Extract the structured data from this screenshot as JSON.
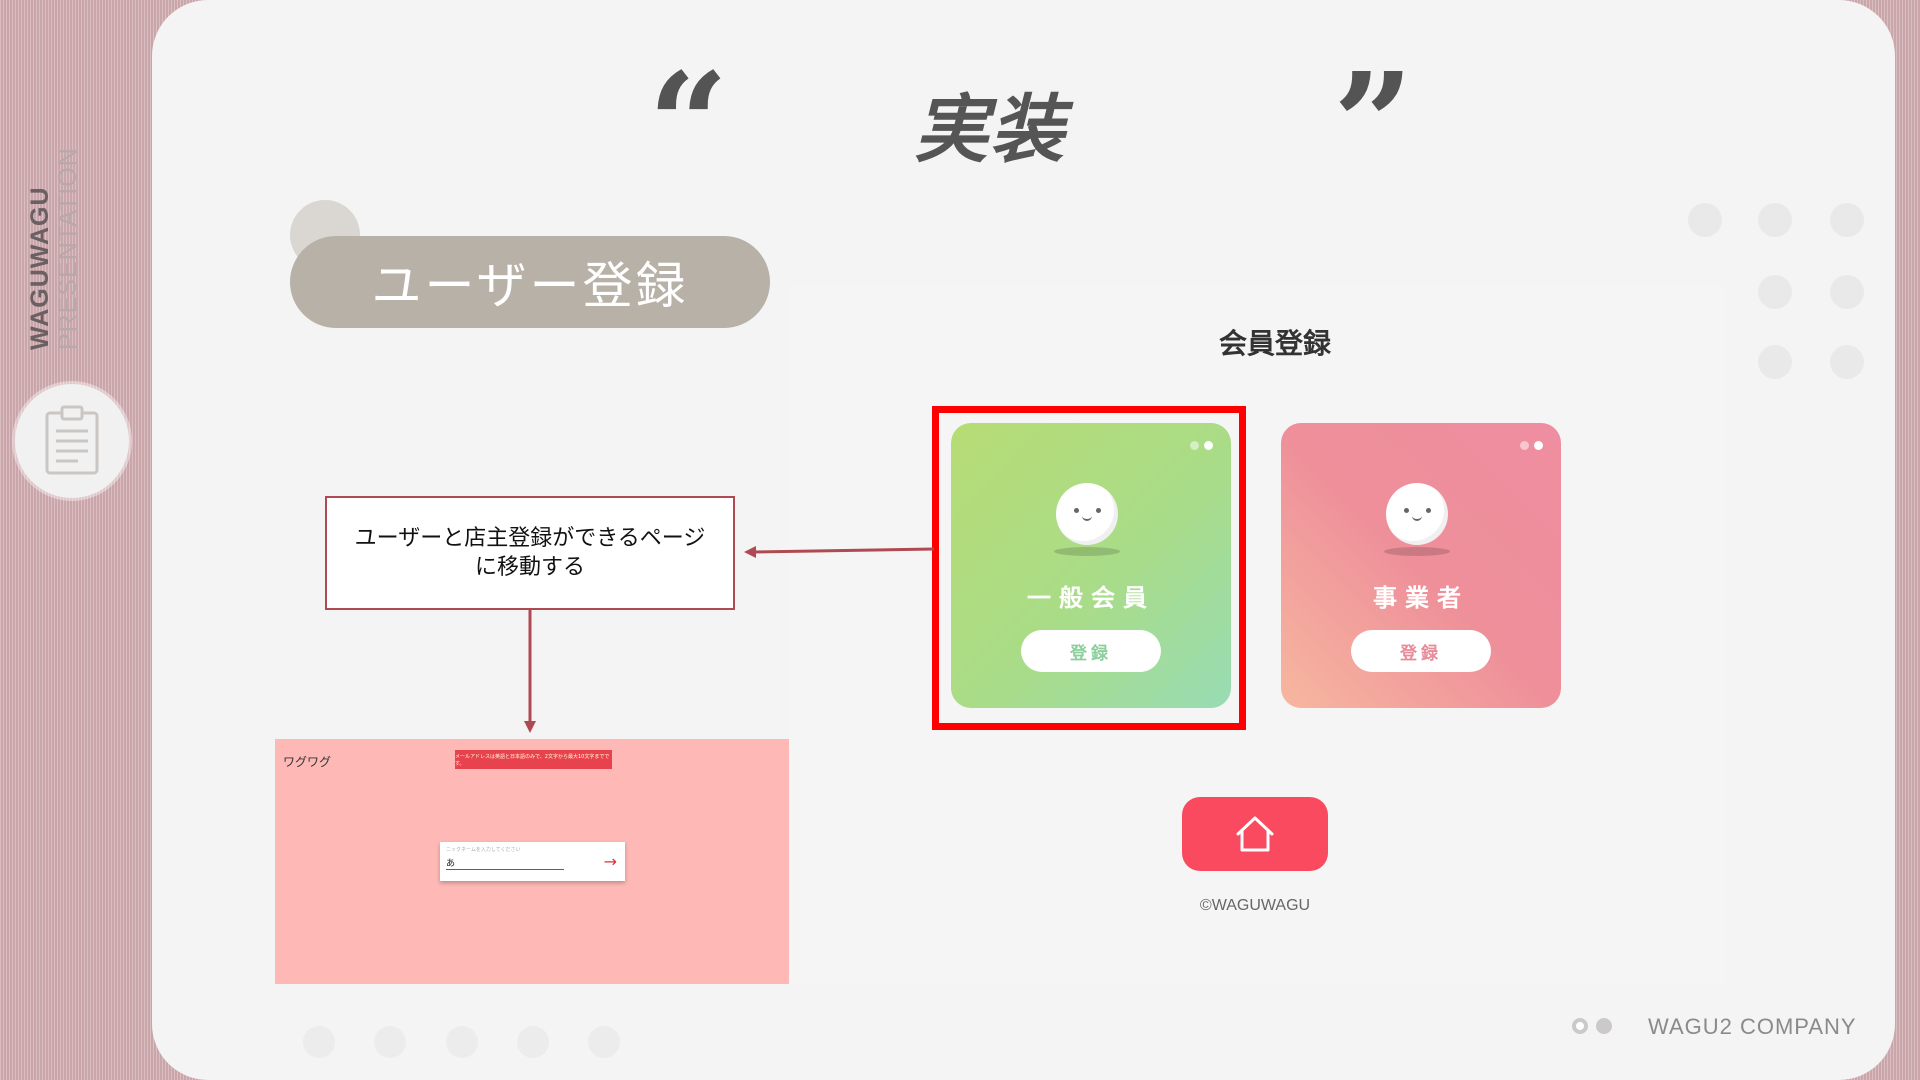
{
  "sidebar": {
    "brand": "WAGUWAGU",
    "subtitle": "PRESENTATION",
    "icon": "clipboard-icon"
  },
  "slide": {
    "title": "実装",
    "section_label": "ユーザー登録"
  },
  "screen": {
    "title": "会員登録",
    "cards": [
      {
        "name": "一般会員",
        "button": "登録"
      },
      {
        "name": "事業者",
        "button": "登録"
      }
    ],
    "home_icon": "home-icon",
    "copyright": "©WAGUWAGU"
  },
  "callout": {
    "line1": "ユーザーと店主登録ができるページ",
    "line2": "に移動する"
  },
  "thumbnail": {
    "brand": "ワグワグ",
    "alert": "メールアドレスは英語と日本語のみで、2文字から最大10文字までです。",
    "input_placeholder": "ニックネームを入力してください",
    "input_value": "あ"
  },
  "footer": {
    "company": "WAGU2 COMPANY"
  },
  "colors": {
    "accent_red": "#f94a5f",
    "highlight": "#ff0000",
    "general_card": "#b7dc75",
    "business_card": "#ef8ea0",
    "pill": "#b7b1a7"
  }
}
